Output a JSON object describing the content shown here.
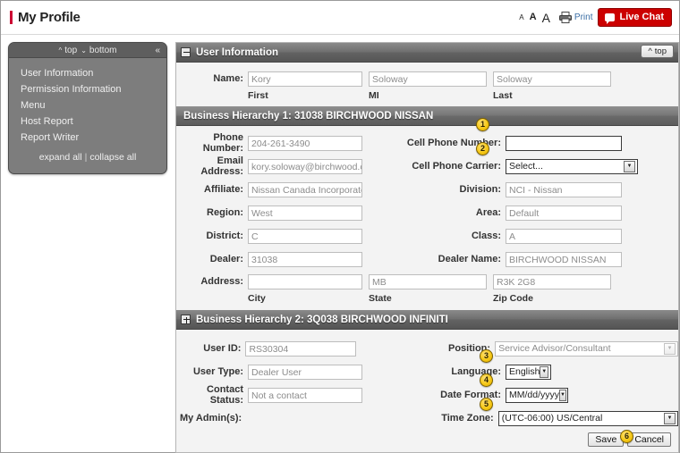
{
  "header": {
    "page_title": "My Profile",
    "font_small": "A",
    "font_medium": "A",
    "font_large": "A",
    "print_label": "Print",
    "live_chat_label": "Live Chat"
  },
  "sidebar": {
    "top_label": "top",
    "bottom_label": "bottom",
    "collapse_label": "«",
    "items": [
      {
        "label": "User Information"
      },
      {
        "label": "Permission Information"
      },
      {
        "label": "Menu"
      },
      {
        "label": "Host Report"
      },
      {
        "label": "Report Writer"
      }
    ],
    "expand_all": "expand all",
    "collapse_all": "collapse all",
    "separator": "|"
  },
  "sections": {
    "user_information": {
      "title": "User Information",
      "top_button": "top",
      "name_label": "Name:",
      "first_value": "Kory",
      "mi_value": "Soloway",
      "last_value": "Soloway",
      "first_sub": "First",
      "mi_sub": "MI",
      "last_sub": "Last"
    },
    "hierarchy1": {
      "title": "Business Hierarchy 1: 31038 BIRCHWOOD NISSAN",
      "fields": {
        "phone_number_label": "Phone Number:",
        "phone_number_value": "204-261-3490",
        "cell_phone_number_label": "Cell Phone Number:",
        "cell_phone_number_value": "",
        "email_label": "Email Address:",
        "email_value": "kory.soloway@birchwood.c",
        "cell_carrier_label": "Cell Phone Carrier:",
        "cell_carrier_value": "Select...",
        "affiliate_label": "Affiliate:",
        "affiliate_value": "Nissan Canada Incorporate",
        "division_label": "Division:",
        "division_value": "NCI - Nissan",
        "region_label": "Region:",
        "region_value": "West",
        "area_label": "Area:",
        "area_value": "Default",
        "district_label": "District:",
        "district_value": "C",
        "class_label": "Class:",
        "class_value": "A",
        "dealer_label": "Dealer:",
        "dealer_value": "31038",
        "dealer_name_label": "Dealer Name:",
        "dealer_name_value": "BIRCHWOOD NISSAN",
        "address_label": "Address:",
        "address_value": "",
        "state_value": "MB",
        "zip_value": "R3K 2G8",
        "city_sub": "City",
        "state_sub": "State",
        "zip_sub": "Zip Code"
      }
    },
    "hierarchy2": {
      "title": "Business Hierarchy 2: 3Q038 BIRCHWOOD INFINITI"
    },
    "account": {
      "user_id_label": "User ID:",
      "user_id_value": "RS30304",
      "position_label": "Position:",
      "position_value": "Service Advisor/Consultant",
      "user_type_label": "User Type:",
      "user_type_value": "Dealer User",
      "language_label": "Language:",
      "language_value": "English",
      "contact_status_label": "Contact Status:",
      "contact_status_value": "Not a contact",
      "date_format_label": "Date Format:",
      "date_format_value": "MM/dd/yyyy",
      "my_admins_label": "My Admin(s):",
      "time_zone_label": "Time Zone:",
      "time_zone_value": "(UTC-06:00) US/Central"
    }
  },
  "footer": {
    "save_label": "Save",
    "cancel_label": "Cancel"
  },
  "callouts": [
    {
      "number": "1"
    },
    {
      "number": "2"
    },
    {
      "number": "3"
    },
    {
      "number": "4"
    },
    {
      "number": "5"
    },
    {
      "number": "6"
    }
  ],
  "colors": {
    "accent_red": "#cc0033",
    "live_chat_red": "#cc0000",
    "badge_yellow": "#f6c816",
    "header_gray": "#6f6f6f",
    "panel_bg": "#f3f3f3"
  }
}
